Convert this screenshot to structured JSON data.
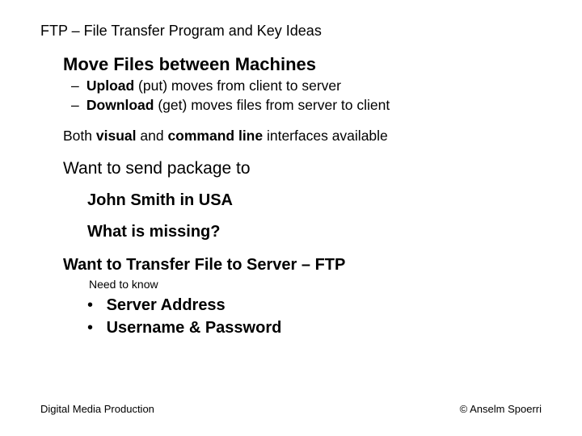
{
  "title": "FTP – File Transfer Program and Key Ideas",
  "main": {
    "heading": "Move Files between Machines",
    "sub1_bold": "Upload",
    "sub1_rest": " (put) moves from client to server",
    "sub2_bold": "Download",
    "sub2_rest": " (get) moves files from server to client"
  },
  "both": {
    "p1": "Both ",
    "b1": "visual",
    "p2": " and ",
    "b2": "command line",
    "p3": " interfaces available"
  },
  "want_send": "Want to send package to",
  "john": "John Smith in USA",
  "missing": "What is missing?",
  "want_transfer": "Want to Transfer File to Server – FTP",
  "need_know": "Need to know",
  "bullets": {
    "b1": "Server Address",
    "b2": "Username & Password"
  },
  "footer": {
    "left": "Digital Media Production",
    "right": "© Anselm Spoerri"
  }
}
